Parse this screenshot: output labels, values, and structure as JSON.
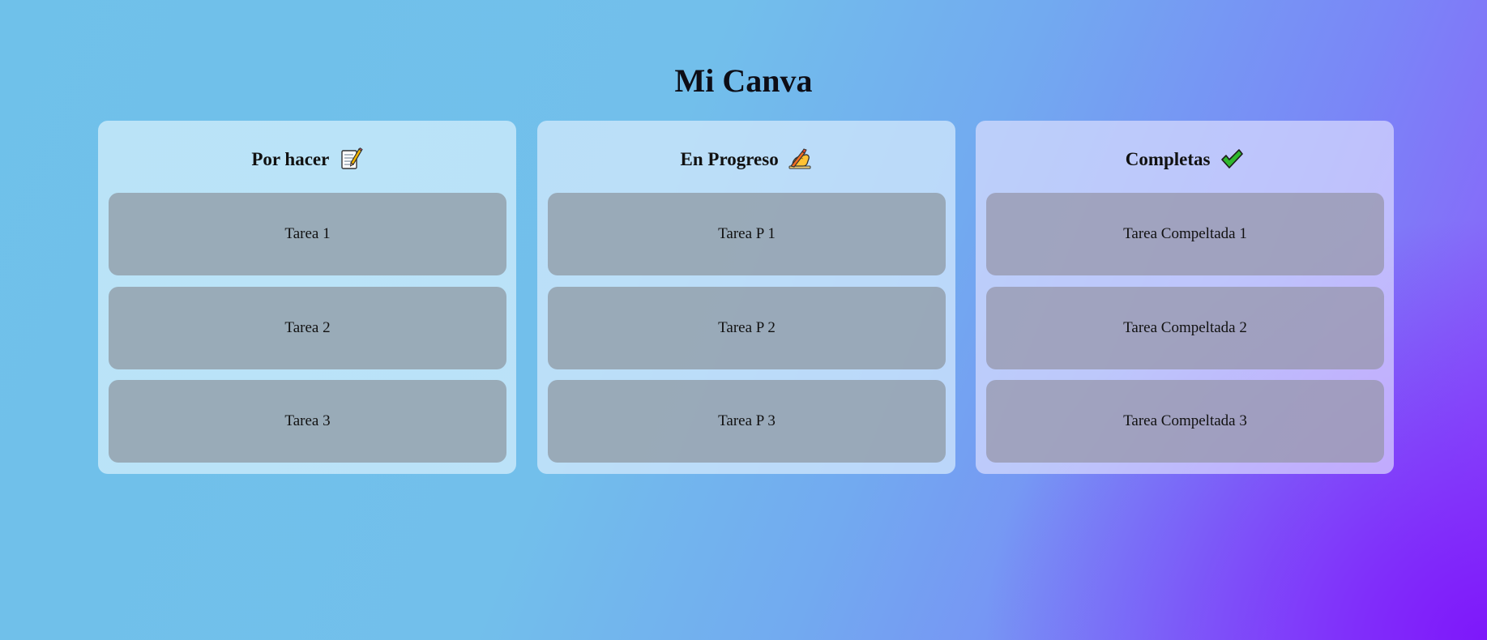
{
  "page": {
    "title": "Mi Canva"
  },
  "columns": [
    {
      "title": "Por hacer",
      "icon": "memo-icon",
      "cards": [
        "Tarea 1",
        "Tarea 2",
        "Tarea 3"
      ]
    },
    {
      "title": "En Progreso",
      "icon": "writing-hand-icon",
      "cards": [
        "Tarea P 1",
        "Tarea P 2",
        "Tarea P 3"
      ]
    },
    {
      "title": "Completas",
      "icon": "check-mark-icon",
      "cards": [
        "Tarea Compeltada 1",
        "Tarea Compeltada 2",
        "Tarea Compeltada 3"
      ]
    }
  ],
  "colors": {
    "background_start": "#6fc1ea",
    "background_end": "#7d14fa",
    "card": "#8c96a0",
    "check": "#2fb82f"
  }
}
